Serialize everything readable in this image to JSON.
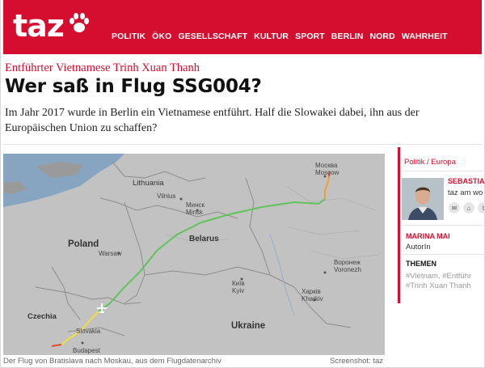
{
  "header": {
    "logo": "taz",
    "nav": [
      "POLITIK",
      "ÖKO",
      "GESELLSCHAFT",
      "KULTUR",
      "SPORT",
      "BERLIN",
      "NORD",
      "WAHRHEIT"
    ],
    "accent": "#d50d2e"
  },
  "article": {
    "kicker": "Entführter Vietnamese Trinh Xuan Thanh",
    "headline": "Wer saß in Flug SSG004?",
    "lead": "Im Jahr 2017 wurde in Berlin ein Vietnamese entführt. Half die Slowakei dabei, ihn aus der Europäischen Union zu schaffen?"
  },
  "map": {
    "labels": {
      "lithuania": "Lithuania",
      "vilnius": "Vilnius",
      "minsk_en": "Минск",
      "minsk": "Minsk",
      "belarus": "Belarus",
      "poland": "Poland",
      "warsaw": "Warsaw",
      "czechia": "Czechia",
      "slovakia": "Slovakia",
      "budapest": "Budapest",
      "ukraine": "Ukraine",
      "kyiv_ru": "Київ",
      "kyiv": "Kyiv",
      "moscow_ru": "Москва",
      "moscow": "Moscow",
      "voronezh_ru": "Воронеж",
      "voronezh": "Voronezh",
      "kharkiv_ru": "Харків",
      "kharkiv": "Kharkiv"
    },
    "caption": "Der Flug von Bratislava nach Moskau, aus dem Flugdatenarchiv",
    "credit": "Screenshot: taz"
  },
  "sidebar": {
    "category": "Politik / Europa",
    "author_name": "SEBASTIAN",
    "author_sub": "taz am wo",
    "icons": [
      "mail-icon",
      "home-icon",
      "twitter-icon"
    ],
    "second_author": "MARINA MAI",
    "second_role": "AutorIn",
    "themen_label": "THEMEN",
    "tags": [
      "#Vietnam,",
      "#Entführ",
      "#Trinh Xuan Thanh"
    ]
  }
}
